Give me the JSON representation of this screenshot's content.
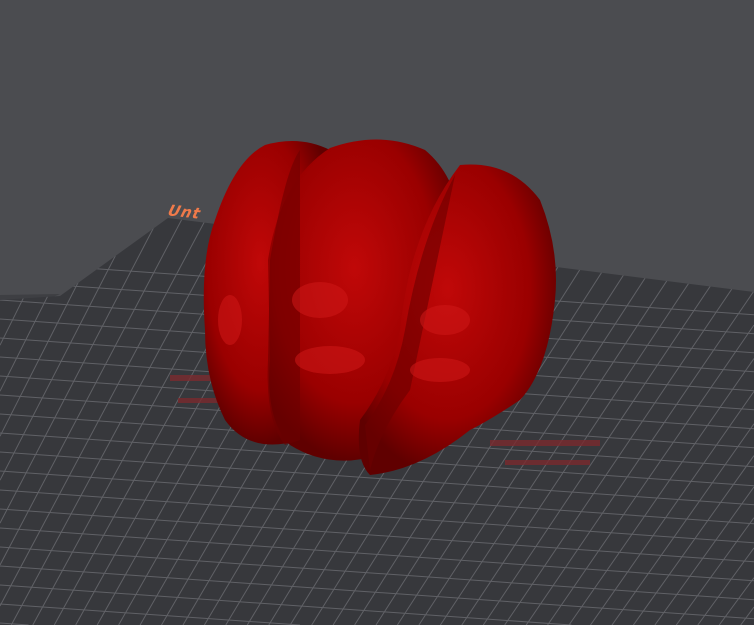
{
  "viewport": {
    "bed_label": "Unt",
    "colors": {
      "background": "#4b4c50",
      "bed": "#35363a",
      "grid": "#5e5f63",
      "model": "#a00000",
      "bed_label": "#f07a4a"
    }
  }
}
